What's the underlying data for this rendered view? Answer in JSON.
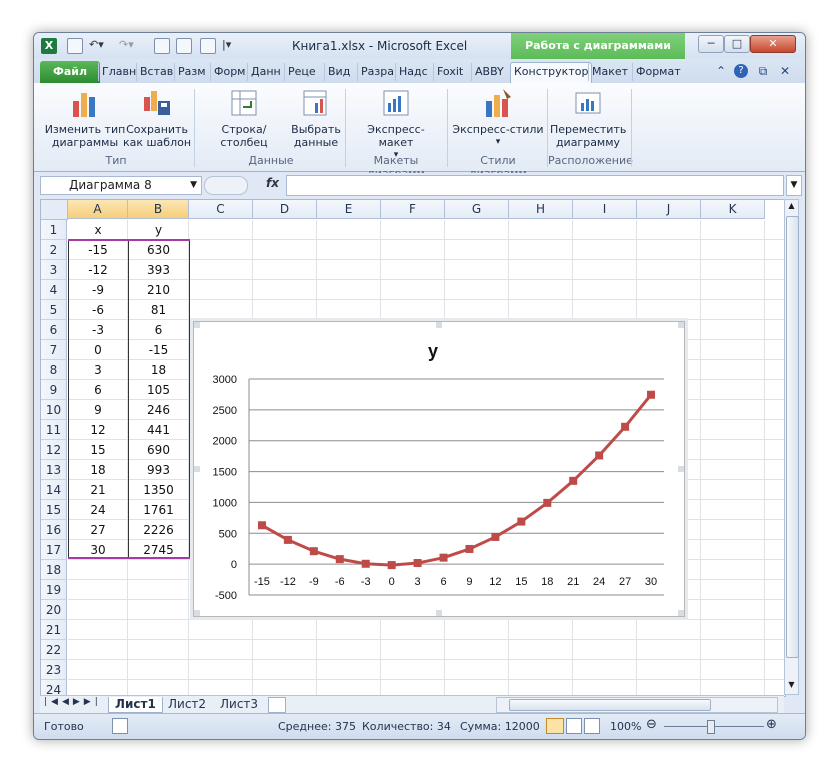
{
  "window": {
    "title": "Книга1.xlsx - Microsoft Excel",
    "context_tab": "Работа с диаграммами"
  },
  "tabs": [
    "Файл",
    "Главн",
    "Встав",
    "Разм",
    "Форм",
    "Данн",
    "Реце",
    "Вид",
    "Разра",
    "Надс",
    "Foxit",
    "ABBY",
    "Конструктор",
    "Макет",
    "Формат"
  ],
  "ribbon": {
    "change_type": "Изменить тип\nдиаграммы",
    "save_template": "Сохранить\nкак шаблон",
    "group_type": "Тип",
    "row_col": "Строка/столбец",
    "select_data": "Выбрать\nданные",
    "group_data": "Данные",
    "express_layout": "Экспресс-макет",
    "group_layouts": "Макеты диаграмм",
    "express_styles": "Экспресс-стили",
    "group_styles": "Стили диаграмм",
    "move_chart": "Переместить\nдиаграмму",
    "group_location": "Расположение"
  },
  "formula_bar": {
    "name_box": "Диаграмма 8",
    "fx_label": "fx",
    "formula": ""
  },
  "grid": {
    "columns": [
      "A",
      "B",
      "C",
      "D",
      "E",
      "F",
      "G",
      "H",
      "I",
      "J",
      "K"
    ],
    "rows": [
      "1",
      "2",
      "3",
      "4",
      "5",
      "6",
      "7",
      "8",
      "9",
      "10",
      "11",
      "12",
      "13",
      "14",
      "15",
      "16",
      "17",
      "18",
      "19",
      "20",
      "21",
      "22",
      "23",
      "24"
    ],
    "header_x": "x",
    "header_y": "y",
    "x_values": [
      "-15",
      "-12",
      "-9",
      "-6",
      "-3",
      "0",
      "3",
      "6",
      "9",
      "12",
      "15",
      "18",
      "21",
      "24",
      "27",
      "30"
    ],
    "y_values": [
      "630",
      "393",
      "210",
      "81",
      "6",
      "-15",
      "18",
      "105",
      "246",
      "441",
      "690",
      "993",
      "1350",
      "1761",
      "2226",
      "2745"
    ]
  },
  "chart_data": {
    "type": "line",
    "title": "y",
    "xlabel": "",
    "ylabel": "",
    "categories": [
      -15,
      -12,
      -9,
      -6,
      -3,
      0,
      3,
      6,
      9,
      12,
      15,
      18,
      21,
      24,
      27,
      30
    ],
    "series": [
      {
        "name": "y",
        "values": [
          630,
          393,
          210,
          81,
          6,
          -15,
          18,
          105,
          246,
          441,
          690,
          993,
          1350,
          1761,
          2226,
          2745
        ],
        "color": "#be4b48"
      }
    ],
    "ylim": [
      -500,
      3000
    ],
    "yticks": [
      -500,
      0,
      500,
      1000,
      1500,
      2000,
      2500,
      3000
    ],
    "grid": true,
    "legend": "none",
    "marker": "square"
  },
  "sheets": [
    "Лист1",
    "Лист2",
    "Лист3"
  ],
  "status": {
    "ready": "Готово",
    "average": "Среднее: 375",
    "count": "Количество: 34",
    "sum": "Сумма: 12000",
    "zoom": "100%"
  }
}
